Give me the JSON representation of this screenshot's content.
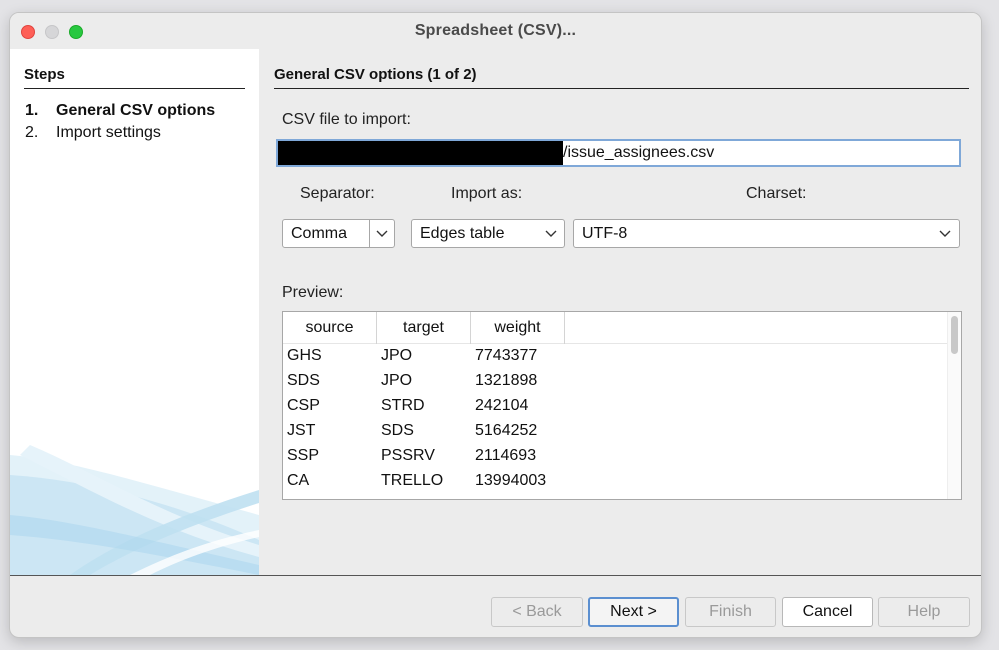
{
  "window": {
    "title": "Spreadsheet (CSV)..."
  },
  "steps": {
    "heading": "Steps",
    "items": [
      {
        "num": "1.",
        "label": "General CSV options",
        "active": true
      },
      {
        "num": "2.",
        "label": "Import settings",
        "active": false
      }
    ]
  },
  "main": {
    "section_title": "General CSV options (1 of 2)",
    "file_label": "CSV file to import:",
    "file_value": "/issue_assignees.csv",
    "separator_label": "Separator:",
    "separator_value": "Comma",
    "import_as_label": "Import as:",
    "import_as_value": "Edges table",
    "charset_label": "Charset:",
    "charset_value": "UTF-8",
    "preview_label": "Preview:",
    "preview": {
      "columns": [
        "source",
        "target",
        "weight"
      ],
      "rows": [
        [
          "GHS",
          "JPO",
          "7743377"
        ],
        [
          "SDS",
          "JPO",
          "1321898"
        ],
        [
          "CSP",
          "STRD",
          "242104"
        ],
        [
          "JST",
          "SDS",
          "5164252"
        ],
        [
          "SSP",
          "PSSRV",
          "2114693"
        ],
        [
          "CA",
          "TRELLO",
          "13994003"
        ]
      ]
    }
  },
  "footer": {
    "back": "< Back",
    "next": "Next >",
    "finish": "Finish",
    "cancel": "Cancel",
    "help": "Help"
  }
}
